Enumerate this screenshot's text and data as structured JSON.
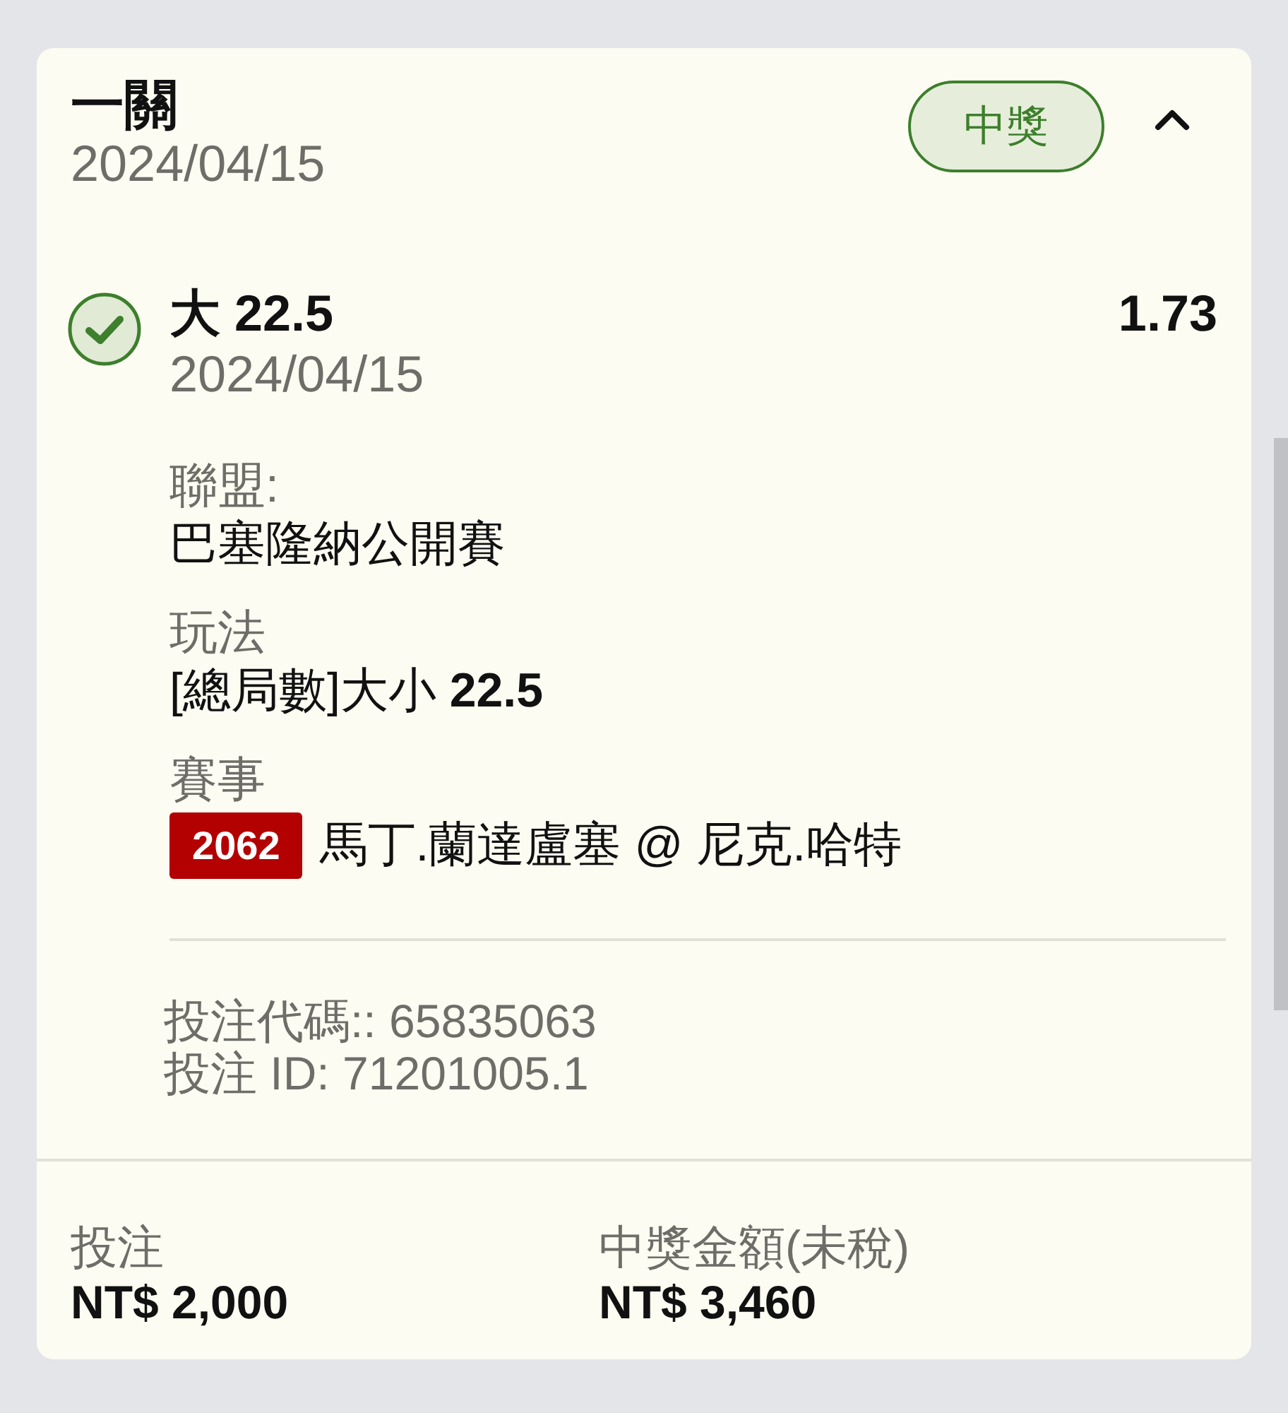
{
  "header": {
    "title": "一關",
    "date": "2024/04/15",
    "status": {
      "label": "中獎",
      "kind": "won"
    },
    "expanded": true
  },
  "selection": {
    "title": "大 22.5",
    "date": "2024/04/15",
    "odds": "1.73",
    "won": true
  },
  "details": [
    {
      "label": "聯盟:",
      "value": "巴塞隆納公開賽"
    },
    {
      "label": "玩法",
      "value": "[總局數]大小 **22.5**"
    },
    {
      "label": "賽事",
      "code": "2062",
      "value": "馬丁.蘭達盧塞 @ 尼克.哈特"
    }
  ],
  "references": [
    "投注代碼:: 65835063",
    "投注 ID: 71201005.1"
  ],
  "footer": [
    {
      "label": "投注",
      "amount": "NT$ 2,000"
    },
    {
      "label": "中獎金額(未稅)",
      "amount": "NT$ 3,460"
    }
  ]
}
